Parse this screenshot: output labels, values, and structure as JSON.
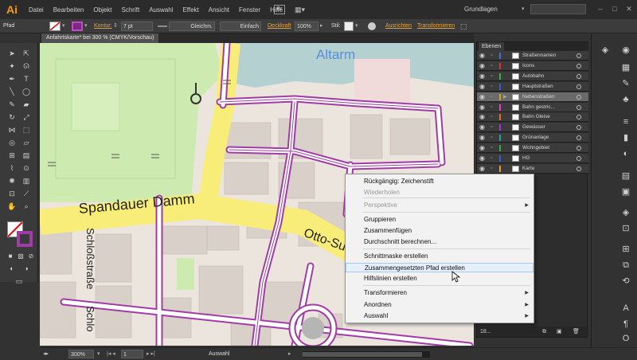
{
  "app": {
    "logo": "Ai",
    "menus": [
      "Datei",
      "Bearbeiten",
      "Objekt",
      "Schrift",
      "Auswahl",
      "Effekt",
      "Ansicht",
      "Fenster",
      "Hilfe"
    ],
    "workspace": "Grundlagen",
    "bridge_label": "Br"
  },
  "controlbar": {
    "object_type": "Pfad",
    "stroke_label": "Kontur:",
    "stroke_weight": "7 pt",
    "profile_label": "Gleichm.",
    "brush_label": "Einfach",
    "opacity_label": "Deckkraft",
    "opacity_value": "100%",
    "style_label": "Stil:",
    "align_label": "Ausrichten",
    "transform_label": "Transformieren"
  },
  "document": {
    "tab_title": "Anfahrtskarte* bei 300 % (CMYK/Vorschau)"
  },
  "map": {
    "labels": {
      "altarm": "Altarm",
      "spandauer_damm": "Spandauer Damm",
      "otto_suhr": "Otto-Suhr",
      "schlossstrasse": "Schloßstraße",
      "schlo": "Schlo"
    },
    "colors": {
      "background": "#ebe5de",
      "water": "#b5d0d0",
      "park": "#cdebb0",
      "building": "#d9d0c9",
      "main_road": "#f9ed7a",
      "selection": "#a03ca5"
    }
  },
  "layers_panel": {
    "tab": "Ebenen",
    "footer_count": "18...",
    "layers": [
      {
        "name": "Straßennamen",
        "color": "#4a6cd4",
        "selected": false
      },
      {
        "name": "Icons",
        "color": "#e0303a",
        "selected": false
      },
      {
        "name": "Autobahn",
        "color": "#3ab24a",
        "selected": false
      },
      {
        "name": "Hauptstraßen",
        "color": "#3a5ad4",
        "selected": false
      },
      {
        "name": "Nebenstraßen",
        "color": "#d4a020",
        "selected": true
      },
      {
        "name": "Bahn gestric...",
        "color": "#e040d0",
        "selected": false
      },
      {
        "name": "Bahn Gleise",
        "color": "#e07020",
        "selected": false
      },
      {
        "name": "Gewässer",
        "color": "#a030e0",
        "selected": false
      },
      {
        "name": "Grünanlage",
        "color": "#20a0a0",
        "selected": false
      },
      {
        "name": "Wohngebiet",
        "color": "#30b040",
        "selected": false
      },
      {
        "name": "HG",
        "color": "#3a5ad4",
        "selected": false
      },
      {
        "name": "Karte",
        "color": "#e0a030",
        "selected": false
      }
    ]
  },
  "context_menu": {
    "items": [
      {
        "label": "Rückgängig: Zeichenstift",
        "disabled": false,
        "submenu": false
      },
      {
        "label": "Wiederholen",
        "disabled": true,
        "submenu": false
      },
      {
        "label": "Perspektive",
        "disabled": true,
        "submenu": true
      },
      {
        "label": "Gruppieren",
        "disabled": false,
        "submenu": false
      },
      {
        "label": "Zusammenfügen",
        "disabled": false,
        "submenu": false
      },
      {
        "label": "Durchschnitt berechnen...",
        "disabled": false,
        "submenu": false
      },
      {
        "label": "Schnittmaske erstellen",
        "disabled": false,
        "submenu": false
      },
      {
        "label": "Zusammengesetzten Pfad erstellen",
        "disabled": false,
        "submenu": false,
        "highlighted": true
      },
      {
        "label": "Hilfslinien erstellen",
        "disabled": false,
        "submenu": false
      },
      {
        "label": "Transformieren",
        "disabled": false,
        "submenu": true
      },
      {
        "label": "Anordnen",
        "disabled": false,
        "submenu": true
      },
      {
        "label": "Auswahl",
        "disabled": false,
        "submenu": true
      }
    ]
  },
  "statusbar": {
    "zoom": "300%",
    "page": "1",
    "tool": "Auswahl"
  }
}
